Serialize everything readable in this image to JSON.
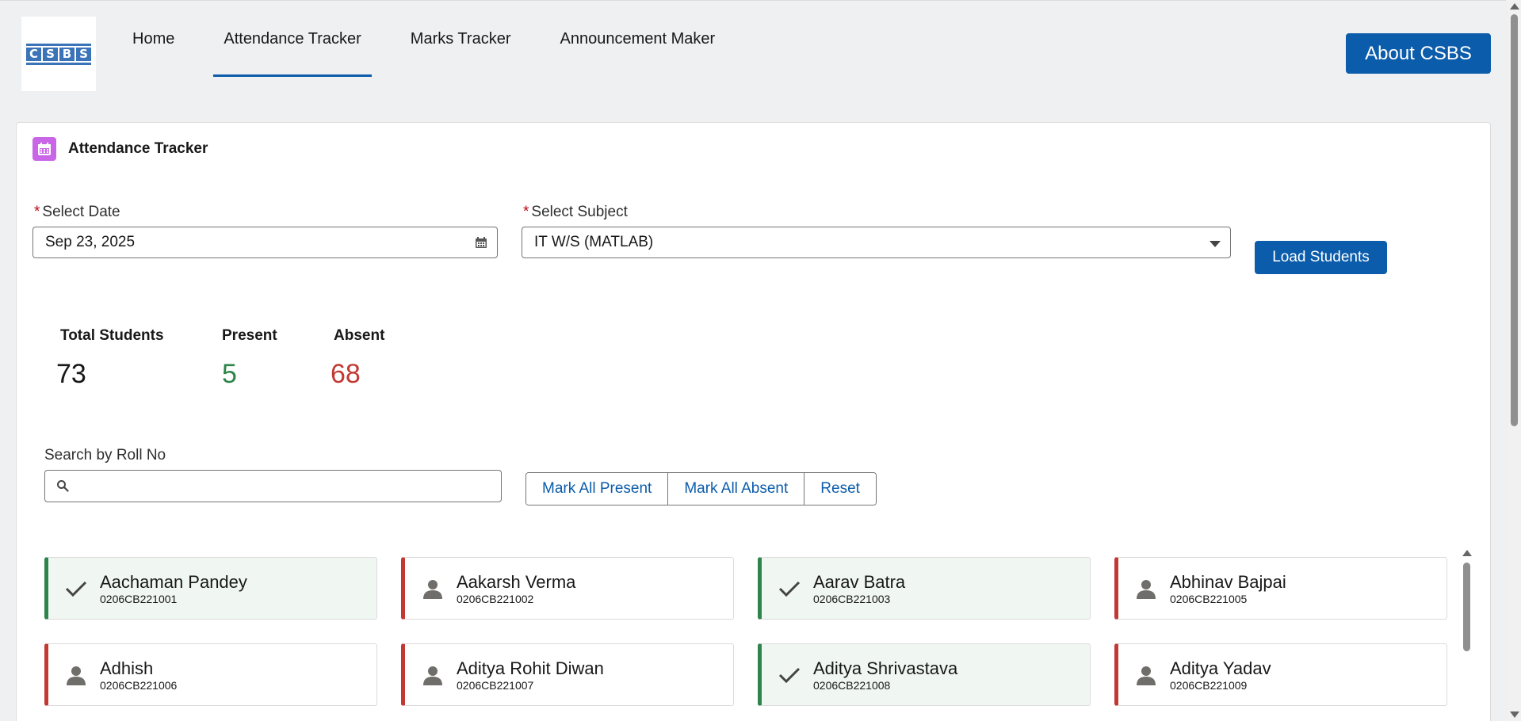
{
  "logo": {
    "letters": [
      "C",
      "S",
      "B",
      "S"
    ]
  },
  "nav": {
    "items": [
      {
        "label": "Home"
      },
      {
        "label": "Attendance Tracker"
      },
      {
        "label": "Marks Tracker"
      },
      {
        "label": "Announcement Maker"
      }
    ],
    "active": "Attendance Tracker"
  },
  "header": {
    "about_label": "About CSBS"
  },
  "card": {
    "title": "Attendance Tracker",
    "date_label": "Select Date",
    "date_value": "Sep 23, 2025",
    "subject_label": "Select Subject",
    "subject_value": "IT W/S (MATLAB)",
    "load_label": "Load Students",
    "required_mark": "*"
  },
  "stats": {
    "total_label": "Total Students",
    "total_value": "73",
    "present_label": "Present",
    "present_value": "5",
    "absent_label": "Absent",
    "absent_value": "68"
  },
  "search": {
    "label": "Search by Roll No",
    "placeholder": ""
  },
  "actions": {
    "mark_present": "Mark All Present",
    "mark_absent": "Mark All Absent",
    "reset": "Reset"
  },
  "students": [
    {
      "name": "Aachaman Pandey",
      "roll": "0206CB221001",
      "status": "present"
    },
    {
      "name": "Aakarsh Verma",
      "roll": "0206CB221002",
      "status": "absent"
    },
    {
      "name": "Aarav Batra",
      "roll": "0206CB221003",
      "status": "present"
    },
    {
      "name": "Abhinav Bajpai",
      "roll": "0206CB221005",
      "status": "absent"
    },
    {
      "name": "Adhish",
      "roll": "0206CB221006",
      "status": "absent"
    },
    {
      "name": "Aditya Rohit Diwan",
      "roll": "0206CB221007",
      "status": "absent"
    },
    {
      "name": "Aditya Shrivastava",
      "roll": "0206CB221008",
      "status": "present"
    },
    {
      "name": "Aditya Yadav",
      "roll": "0206CB221009",
      "status": "absent"
    }
  ],
  "colors": {
    "brand": "#0b5cab",
    "present": "#2e844a",
    "absent": "#c23934",
    "card_icon": "#c966e8"
  }
}
